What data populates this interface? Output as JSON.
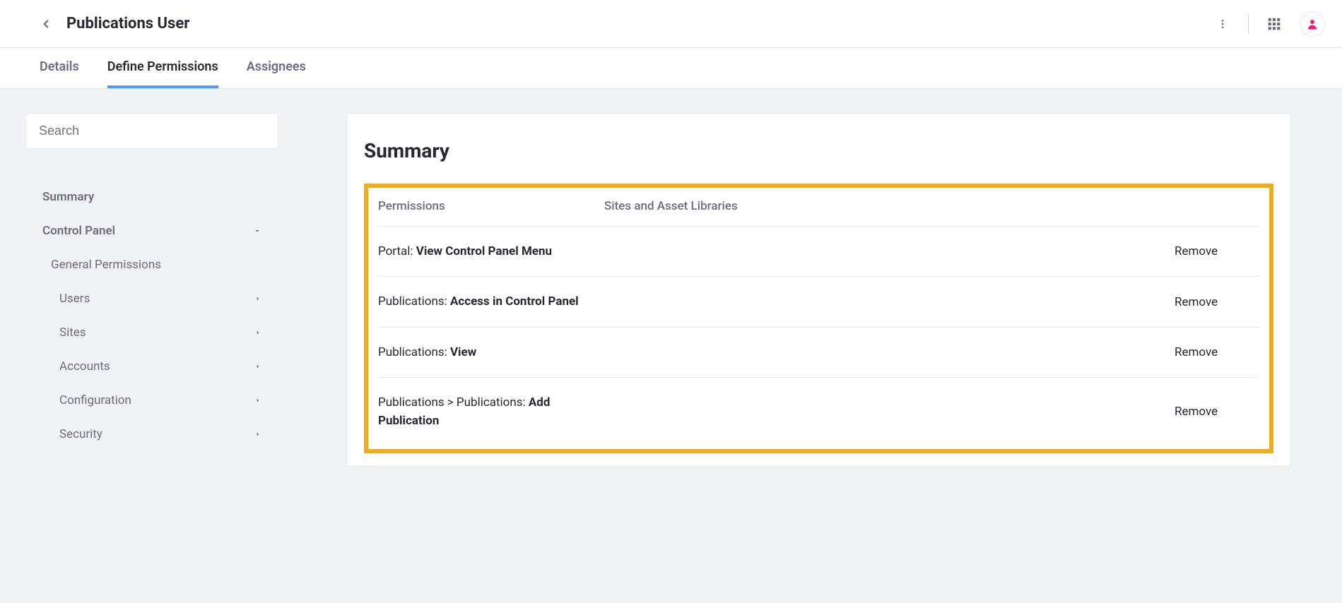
{
  "header": {
    "title": "Publications User"
  },
  "tabs": [
    {
      "label": "Details",
      "active": false
    },
    {
      "label": "Define Permissions",
      "active": true
    },
    {
      "label": "Assignees",
      "active": false
    }
  ],
  "sidebar": {
    "search_placeholder": "Search",
    "summary_label": "Summary",
    "control_panel_label": "Control Panel",
    "general_permissions_label": "General Permissions",
    "items": [
      {
        "label": "Users"
      },
      {
        "label": "Sites"
      },
      {
        "label": "Accounts"
      },
      {
        "label": "Configuration"
      },
      {
        "label": "Security"
      }
    ]
  },
  "summary": {
    "title": "Summary",
    "header_permissions": "Permissions",
    "header_sites": "Sites and Asset Libraries",
    "remove_label": "Remove",
    "rows": [
      {
        "prefix": "Portal: ",
        "bold": "View Control Panel Menu"
      },
      {
        "prefix": "Publications: ",
        "bold": "Access in Control Panel"
      },
      {
        "prefix": "Publications: ",
        "bold": "View"
      },
      {
        "prefix": "Publications > Publications: ",
        "bold": "Add Publication"
      }
    ]
  }
}
